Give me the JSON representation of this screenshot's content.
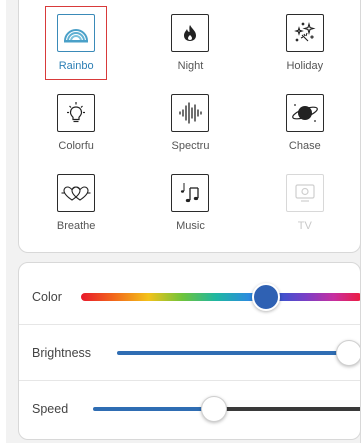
{
  "modes": [
    {
      "label": "Rainbo",
      "icon": "rainbow-icon",
      "selected": true,
      "disabled": false
    },
    {
      "label": "Night",
      "icon": "flame-icon",
      "selected": false,
      "disabled": false
    },
    {
      "label": "Holiday",
      "icon": "fireworks-icon",
      "selected": false,
      "disabled": false
    },
    {
      "label": "Colorfu",
      "icon": "lightbulb-icon",
      "selected": false,
      "disabled": false
    },
    {
      "label": "Spectru",
      "icon": "sound-wave-icon",
      "selected": false,
      "disabled": false
    },
    {
      "label": "Chase",
      "icon": "planet-icon",
      "selected": false,
      "disabled": false
    },
    {
      "label": "Breathe",
      "icon": "hearts-icon",
      "selected": false,
      "disabled": false
    },
    {
      "label": "Music",
      "icon": "music-notes-icon",
      "selected": false,
      "disabled": false
    },
    {
      "label": "TV",
      "icon": "tv-icon",
      "selected": false,
      "disabled": true
    }
  ],
  "controls": {
    "color": {
      "label": "Color",
      "value": 0.66
    },
    "brightness": {
      "label": "Brightness",
      "value": 1.0
    },
    "speed": {
      "label": "Speed",
      "value": 0.45
    }
  },
  "colors": {
    "selected_accent": "#2d7fb5",
    "selection_frame": "#d83a3a",
    "slider_fill": "#2f6db3",
    "slider_rest": "#3a3a3a",
    "color_knob": "#2f61b3"
  }
}
